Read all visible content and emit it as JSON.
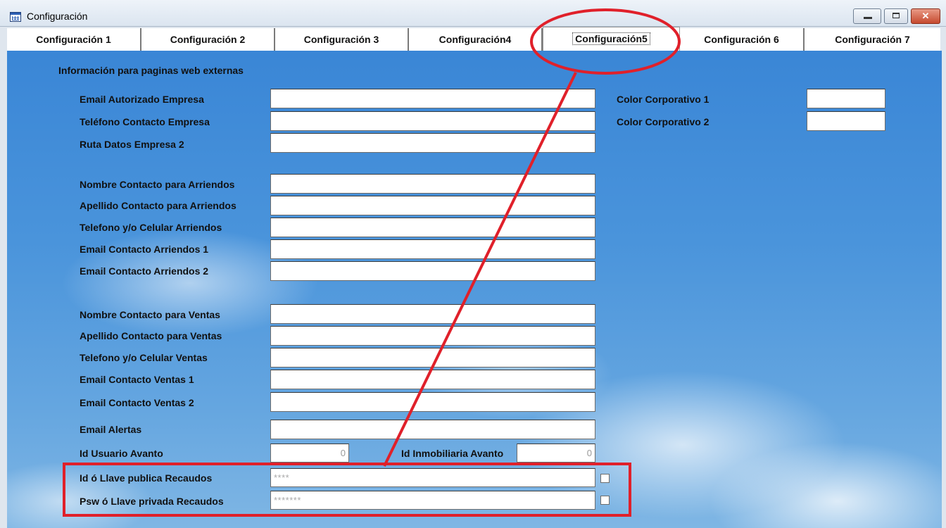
{
  "window": {
    "title": "Configuración",
    "icon": "table-icon"
  },
  "tabs": [
    {
      "label": "Configuración 1",
      "active": false
    },
    {
      "label": "Configuración 2",
      "active": false
    },
    {
      "label": "Configuración 3",
      "active": false
    },
    {
      "label": "Configuración4",
      "active": false
    },
    {
      "label": "Configuración5",
      "active": true
    },
    {
      "label": "Configuración 6",
      "active": false
    },
    {
      "label": "Configuración 7",
      "active": false
    }
  ],
  "form": {
    "section_title": "Información para paginas web externas",
    "labels": {
      "email_autorizado": "Email Autorizado Empresa",
      "telefono_contacto": "Teléfono Contacto Empresa",
      "ruta_datos": "Ruta Datos Empresa 2",
      "color_corp_1": "Color Corporativo 1",
      "color_corp_2": "Color Corporativo 2",
      "nombre_arriendos": "Nombre Contacto para Arriendos",
      "apellido_arriendos": "Apellido Contacto para Arriendos",
      "telefono_arriendos": "Telefono y/o Celular Arriendos",
      "email_arriendos_1": "Email Contacto Arriendos 1",
      "email_arriendos_2": "Email Contacto Arriendos 2",
      "nombre_ventas": "Nombre Contacto para Ventas",
      "apellido_ventas": "Apellido Contacto para Ventas",
      "telefono_ventas": "Telefono y/o Celular Ventas",
      "email_ventas_1": "Email Contacto Ventas 1",
      "email_ventas_2": "Email Contacto Ventas 2",
      "email_alertas": "Email Alertas",
      "id_usuario_avanto": "Id Usuario Avanto",
      "id_inmobiliaria_avanto": "Id Inmobiliaria Avanto",
      "llave_publica": "Id ó Llave publica Recaudos",
      "llave_privada": "Psw ó Llave privada  Recaudos"
    },
    "values": {
      "email_autorizado": "",
      "telefono_contacto": "",
      "ruta_datos": "",
      "color_corp_1": "",
      "color_corp_2": "",
      "nombre_arriendos": "",
      "apellido_arriendos": "",
      "telefono_arriendos": "",
      "email_arriendos_1": "",
      "email_arriendos_2": "",
      "nombre_ventas": "",
      "apellido_ventas": "",
      "telefono_ventas": "",
      "email_ventas_1": "",
      "email_ventas_2": "",
      "email_alertas": "",
      "id_usuario_avanto": "0",
      "id_inmobiliaria_avanto": "0",
      "llave_publica": "****",
      "llave_privada": "*******"
    },
    "checkboxes": {
      "mostrar_llave_publica": false,
      "mostrar_llave_privada": false
    }
  },
  "annotation": {
    "color": "#e0202a"
  }
}
